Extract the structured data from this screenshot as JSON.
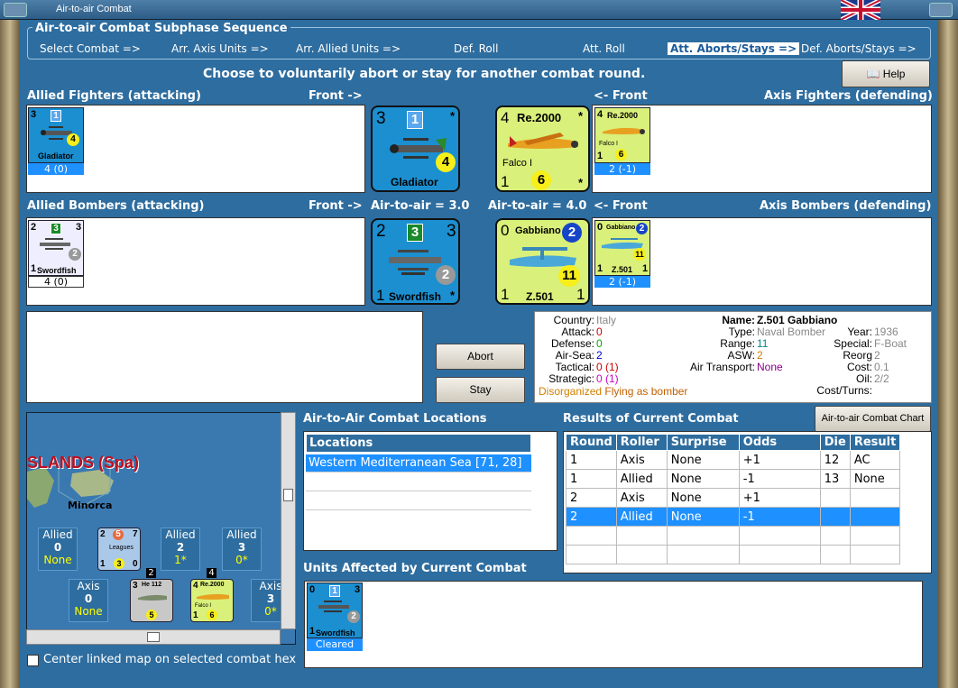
{
  "window": {
    "title": "Air-to-air Combat"
  },
  "sequence": {
    "title": "Air-to-air Combat Subphase Sequence",
    "steps": [
      "Select Combat =>",
      "Arr. Axis Units =>",
      "Arr. Allied Units =>",
      "Def. Roll",
      "Att. Roll",
      "Att. Aborts/Stays =>",
      "Def. Aborts/Stays =>"
    ],
    "active_index": 5
  },
  "instruction": "Choose to voluntarily abort or stay for another combat round.",
  "help_label": "Help",
  "allied_fighters": {
    "header": "Allied Fighters (attacking)",
    "front": "Front ->",
    "counter": {
      "name": "Gladiator",
      "attack": "3",
      "defense": "1",
      "move": "4",
      "status": "4 (0)"
    }
  },
  "axis_fighters": {
    "header": "Axis Fighters (defending)",
    "front": "<- Front",
    "counter": {
      "name": "Re.2000",
      "sub": "Falco I",
      "attack": "4",
      "range": "1",
      "move": "6",
      "status": "2 (-1)"
    }
  },
  "allied_bombers": {
    "header": "Allied Bombers (attacking)",
    "front": "Front ->",
    "air_to_air": "Air-to-air = 3.0",
    "counter": {
      "name": "Swordfish",
      "attack": "2",
      "defense": "3",
      "right": "3",
      "move": "2",
      "range": "1",
      "status": "4 (0)"
    }
  },
  "axis_bombers": {
    "header": "Axis Bombers (defending)",
    "front": "<- Front",
    "air_to_air": "Air-to-air = 4.0",
    "counter": {
      "name": "Z.501",
      "title": "Gabbiano",
      "attack": "0",
      "defense": "2",
      "move": "11",
      "range": "1",
      "right": "1",
      "status": "2 (-1)"
    }
  },
  "buttons": {
    "abort": "Abort",
    "stay": "Stay",
    "chart": "Air-to-air Combat Chart"
  },
  "unit_info": {
    "country_label": "Country:",
    "country": "Italy",
    "attack_label": "Attack:",
    "attack": "0",
    "defense_label": "Defense:",
    "defense": "0",
    "airsea_label": "Air-Sea:",
    "airsea": "2",
    "tactical_label": "Tactical:",
    "tactical": "0 (1)",
    "strategic_label": "Strategic:",
    "strategic": "0 (1)",
    "status1": "Disorganized",
    "status2": "Flying as bomber",
    "name_label": "Name:",
    "name": "Z.501 Gabbiano",
    "type_label": "Type:",
    "type": "Naval Bomber",
    "year_label": "Year:",
    "year": "1936",
    "range_label": "Range:",
    "range": "11",
    "special_label": "Special:",
    "special": "F-Boat",
    "asw_label": "ASW:",
    "asw": "2",
    "reorg_label": "Reorg Cost:",
    "reorg": "2",
    "airtransport_label": "Air Transport:",
    "airtransport": "None",
    "oil_label": "Oil:",
    "oil": "0.1",
    "cost_label": "Cost/Turns:",
    "cost": "2/2"
  },
  "map": {
    "region": "SLANDS (Spa)",
    "island": "Minorca",
    "boxes": [
      {
        "side": "Allied",
        "value": "0",
        "note": "None"
      },
      {
        "side": "Allied",
        "value": "2",
        "note": "1*"
      },
      {
        "side": "Allied",
        "value": "3",
        "note": "0*"
      },
      {
        "side": "Axis",
        "value": "0",
        "note": "None"
      },
      {
        "side": "Axis",
        "value": "3",
        "note": "0*"
      }
    ],
    "units": [
      {
        "name": "Leagues",
        "a": "2",
        "b": "5",
        "c": "7",
        "d": "1",
        "e": "3",
        "f": "0"
      },
      {
        "name": "He 112",
        "a": "3",
        "stack": "2",
        "move": "5"
      },
      {
        "name": "Re.2000",
        "sub": "Falco I",
        "a": "4",
        "stack": "4",
        "d": "1",
        "e": "6"
      }
    ],
    "center_label": "Center linked map on selected combat hex"
  },
  "locations": {
    "header": "Air-to-Air Combat Locations",
    "col": "Locations",
    "rows": [
      "Western Mediterranean Sea [71, 28]"
    ]
  },
  "results": {
    "header": "Results of Current Combat",
    "columns": [
      "Round",
      "Roller",
      "Surprise",
      "Odds",
      "Die",
      "Result"
    ],
    "rows": [
      [
        "1",
        "Axis",
        "None",
        "+1",
        "12",
        "AC"
      ],
      [
        "1",
        "Allied",
        "None",
        "-1",
        "13",
        "None"
      ],
      [
        "2",
        "Axis",
        "None",
        "+1",
        "",
        ""
      ],
      [
        "2",
        "Allied",
        "None",
        "-1",
        "",
        ""
      ]
    ],
    "selected_row": 3
  },
  "affected": {
    "header": "Units Affected by Current Combat",
    "counter": {
      "name": "Swordfish",
      "a": "0",
      "b": "1",
      "c": "3",
      "d": "1",
      "move": "2",
      "status": "Cleared"
    }
  },
  "colors": {
    "background": "#2e6d9f",
    "counter_blue": "#1b8fd0",
    "counter_lime": "#d9f07a",
    "select": "#1e90ff"
  }
}
